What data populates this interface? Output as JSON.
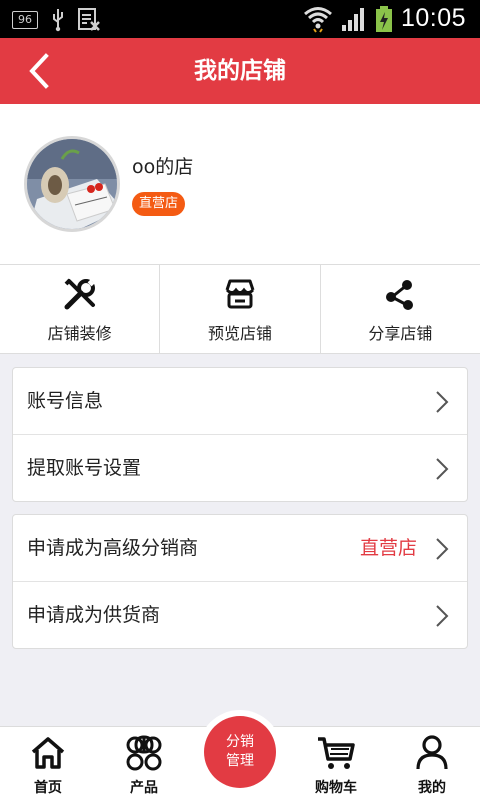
{
  "status_bar": {
    "notification_count": "96",
    "time": "10:05"
  },
  "header": {
    "title": "我的店铺"
  },
  "profile": {
    "shop_name": "oo的店",
    "badge": "直营店"
  },
  "actions": [
    {
      "label": "店铺装修",
      "icon": "tools-icon"
    },
    {
      "label": "预览店铺",
      "icon": "store-icon"
    },
    {
      "label": "分享店铺",
      "icon": "share-icon"
    }
  ],
  "menu_group_1": [
    {
      "label": "账号信息"
    },
    {
      "label": "提取账号设置"
    }
  ],
  "menu_group_2": [
    {
      "label": "申请成为高级分销商",
      "value": "直营店"
    },
    {
      "label": "申请成为供货商"
    }
  ],
  "tabbar": {
    "tabs": [
      {
        "label": "首页",
        "icon": "home-icon"
      },
      {
        "label": "产品",
        "icon": "products-icon"
      },
      {
        "label": "购物车",
        "icon": "cart-icon"
      },
      {
        "label": "我的",
        "icon": "user-icon"
      }
    ],
    "center": {
      "line1": "分销",
      "line2": "管理"
    }
  },
  "colors": {
    "accent": "#e23b43",
    "badge": "#f45b13",
    "background": "#efeff4"
  }
}
